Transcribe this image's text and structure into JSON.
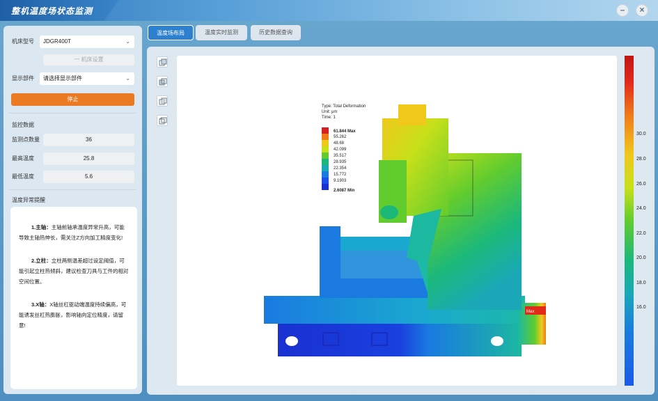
{
  "window": {
    "title": "整机温度场状态监测",
    "minimize": "–",
    "close": "×"
  },
  "sidebar": {
    "machine_label": "机床型号",
    "machine_value": "JDGR400T",
    "setup_button": "一 机床设置",
    "display_label": "显示部件",
    "display_placeholder": "请选择显示部件",
    "stop_button": "停止",
    "monitor_title": "监控数据",
    "stats": [
      {
        "label": "监测点数量",
        "value": "36"
      },
      {
        "label": "最高温度",
        "value": "25.8"
      },
      {
        "label": "最低温度",
        "value": "5.6"
      }
    ],
    "alert_title": "温度异常提醒",
    "alerts": [
      {
        "head": "1.主轴：",
        "text": "主轴前轴承温度异常升高，可能导致主轴热伸长，需关注Z方向加工精度变化!"
      },
      {
        "head": "2.立柱：",
        "text": "立柱两侧温差超过设定阈值，可能引起立柱热倾斜，建议检查刀具与工件的相对空间位置。"
      },
      {
        "head": "3.X轴：",
        "text": "X轴丝杠驱动端温度持续偏高，可能诱发丝杠热膨胀，影响轴向定位精度，请留意!"
      }
    ]
  },
  "tabs": [
    {
      "label": "温度场布局",
      "active": true
    },
    {
      "label": "温度实时监测",
      "active": false
    },
    {
      "label": "历史数据查询",
      "active": false
    }
  ],
  "tools": [
    "iso-view-icon",
    "front-view-icon",
    "side-view-icon",
    "top-view-icon"
  ],
  "legend": {
    "type": "Type: Total Deformation",
    "unit": "Unit: μm",
    "time": "Time: 1",
    "max_label": "61.844 Max",
    "values": [
      "55.262",
      "48.68",
      "42.099",
      "35.517",
      "28.935",
      "22.354",
      "15.772",
      "9.1903"
    ],
    "min_label": "2.6087 Min",
    "colors": [
      "#d42020",
      "#f07a1a",
      "#f0c81c",
      "#c8e01a",
      "#62cc2e",
      "#1cb87a",
      "#1aa8b8",
      "#1a7ae0",
      "#1a50e8",
      "#1a30d0"
    ],
    "max_marker": "Max"
  },
  "colorbar": {
    "ticks": [
      "30.0",
      "28.0",
      "26.0",
      "24.0",
      "22.0",
      "20.0",
      "18.0",
      "16.0"
    ]
  }
}
